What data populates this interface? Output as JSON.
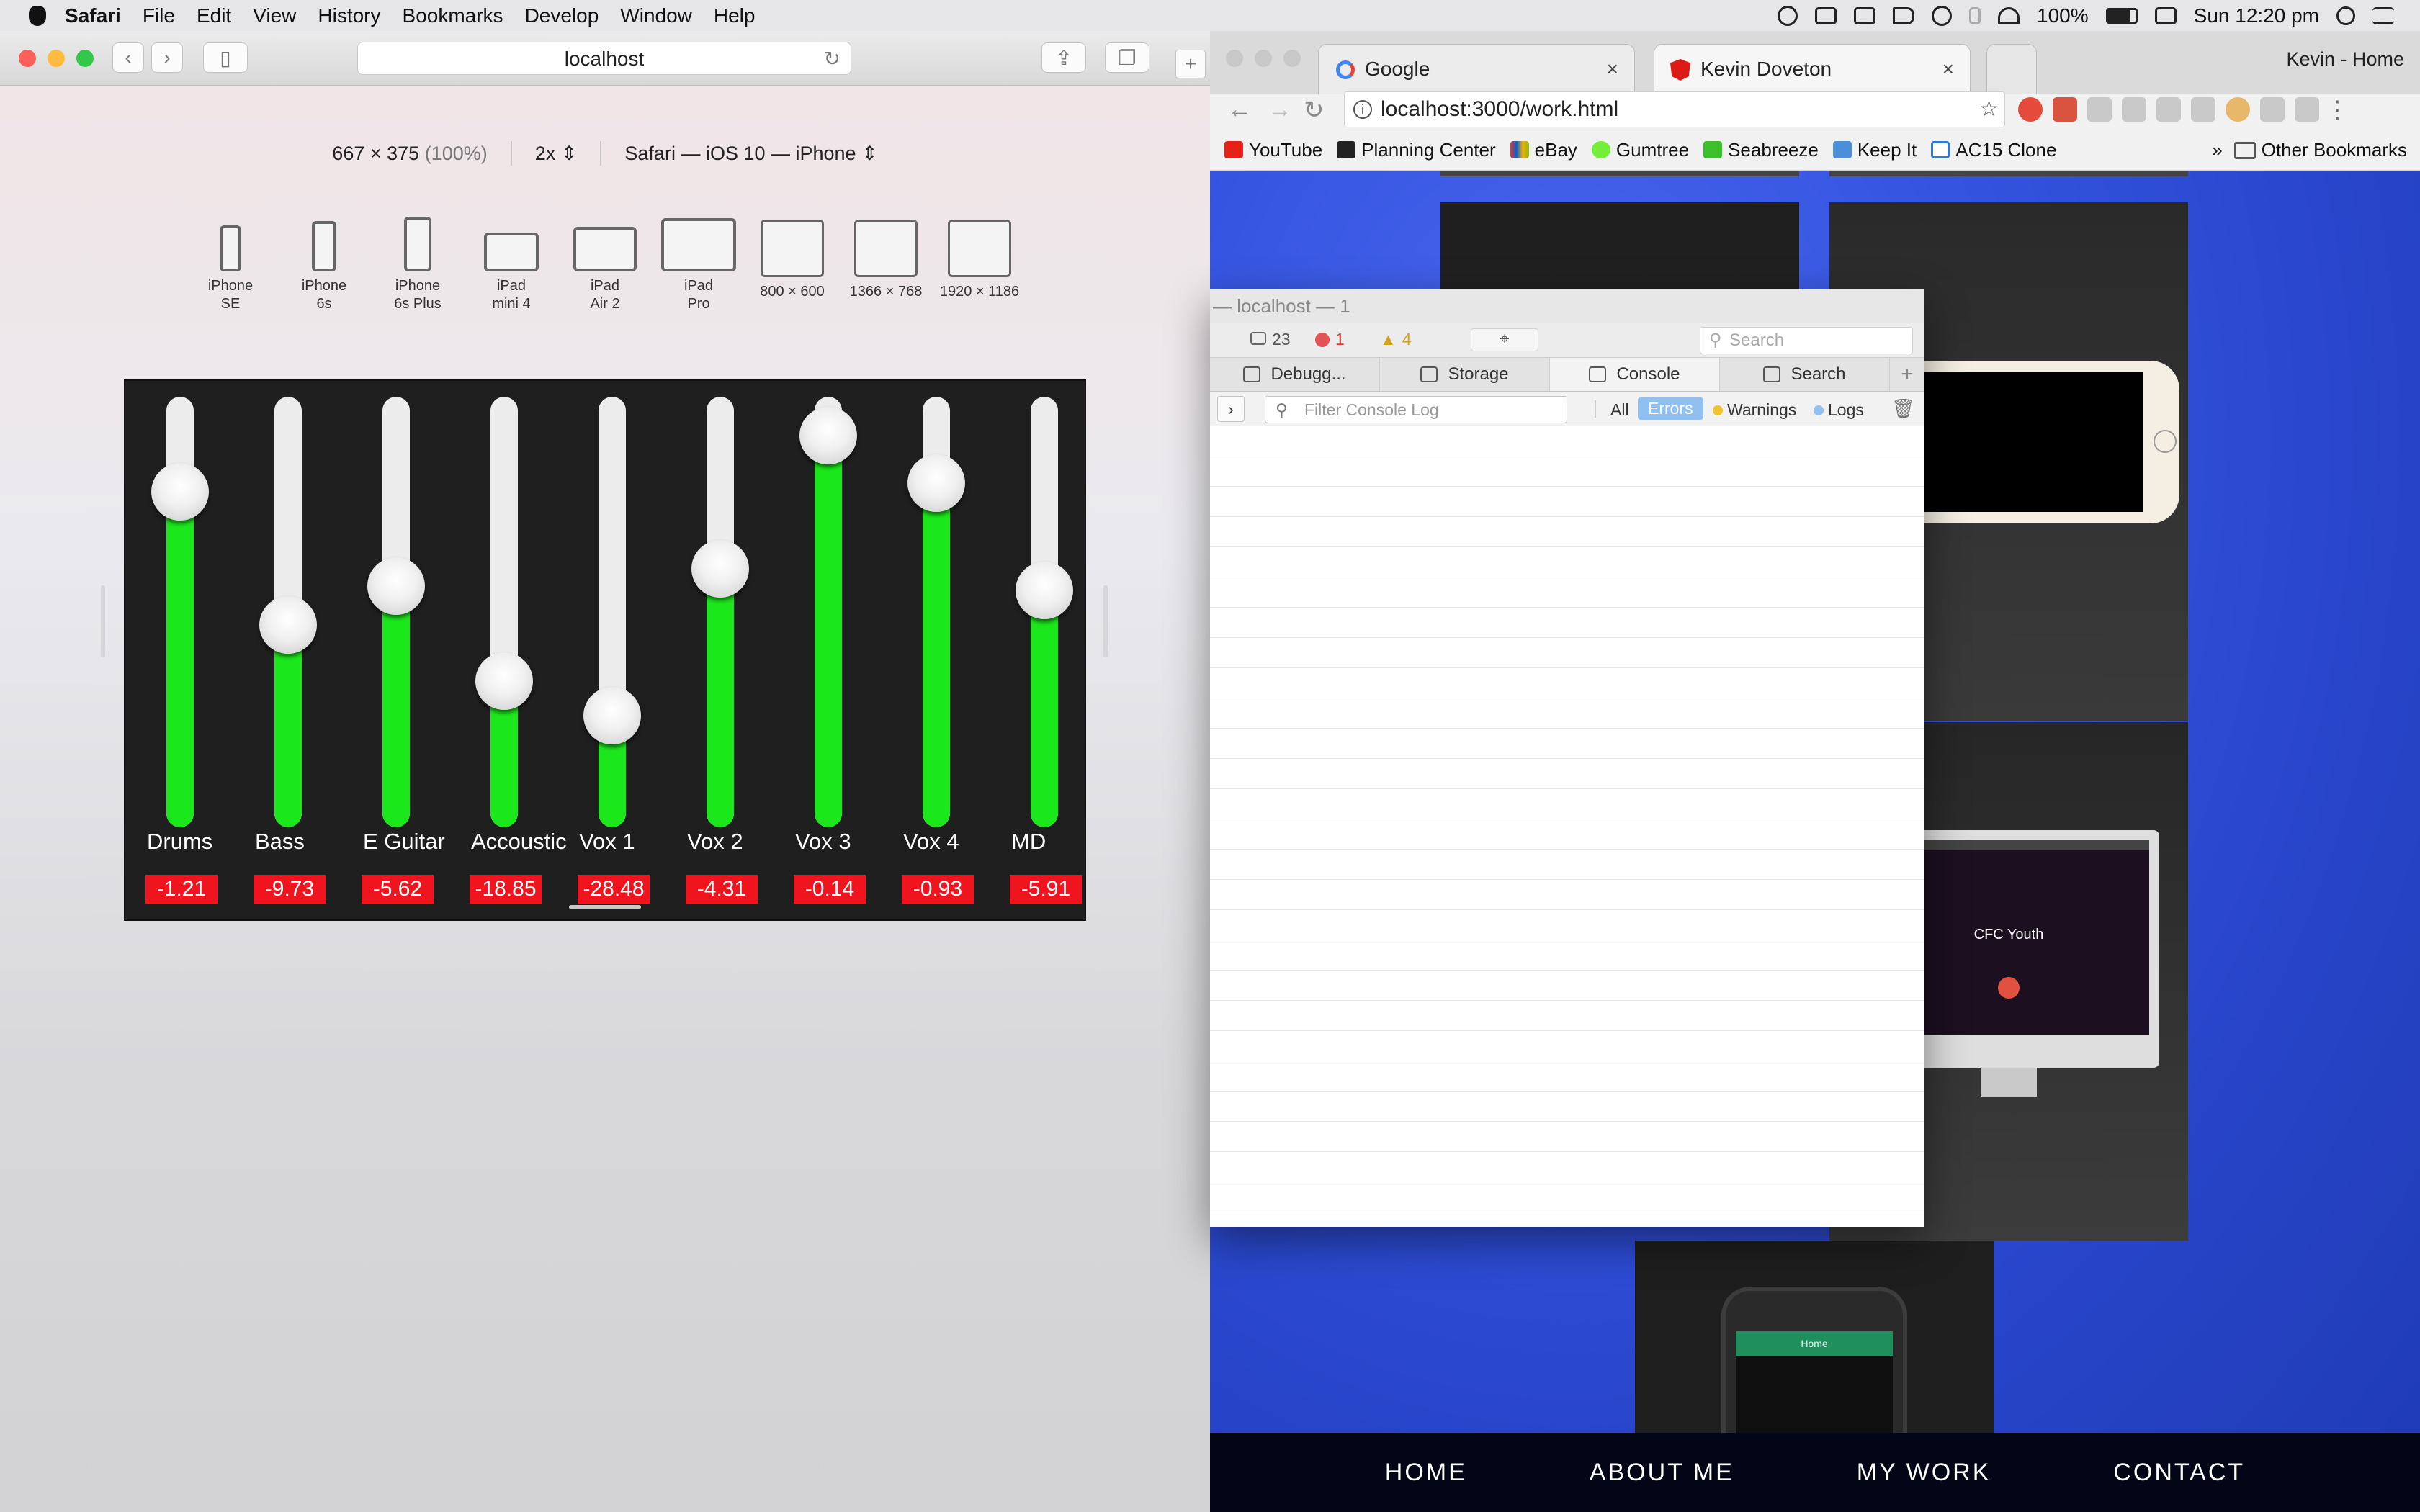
{
  "menubar": {
    "app": "Safari",
    "items": [
      "File",
      "Edit",
      "View",
      "History",
      "Bookmarks",
      "Develop",
      "Window",
      "Help"
    ],
    "battery": "100%",
    "clock": "Sun 12:20 pm"
  },
  "safari": {
    "url": "localhost",
    "responsive": {
      "size": "667 × 375",
      "zoom": "(100%)",
      "scale": "2x",
      "agent": "Safari — iOS 10 — iPhone"
    },
    "devices": [
      {
        "l1": "iPhone",
        "l2": "SE"
      },
      {
        "l1": "iPhone",
        "l2": "6s"
      },
      {
        "l1": "iPhone",
        "l2": "6s Plus"
      },
      {
        "l1": "iPad",
        "l2": "mini 4"
      },
      {
        "l1": "iPad",
        "l2": "Air 2"
      },
      {
        "l1": "iPad",
        "l2": "Pro"
      },
      {
        "l1": "800 × 600",
        "l2": ""
      },
      {
        "l1": "1366 × 768",
        "l2": ""
      },
      {
        "l1": "1920 × 1186",
        "l2": ""
      }
    ],
    "mixer": {
      "fill_color": "#1be81b",
      "value_bg": "#f0141e",
      "channels": [
        {
          "name": "Drums",
          "value": "-1.21",
          "level": 0.78
        },
        {
          "name": "Bass",
          "value": "-9.73",
          "level": 0.47
        },
        {
          "name": "E Guitar",
          "value": "-5.62",
          "level": 0.56
        },
        {
          "name": "Accoustic",
          "value": "-18.85",
          "level": 0.34
        },
        {
          "name": "Vox 1",
          "value": "-28.48",
          "level": 0.26
        },
        {
          "name": "Vox 2",
          "value": "-4.31",
          "level": 0.6
        },
        {
          "name": "Vox 3",
          "value": "-0.14",
          "level": 0.91
        },
        {
          "name": "Vox 4",
          "value": "-0.93",
          "level": 0.8
        },
        {
          "name": "MD",
          "value": "-5.91",
          "level": 0.55
        }
      ]
    }
  },
  "chrome": {
    "tabs": [
      {
        "title": "Google"
      },
      {
        "title": "Kevin Doveton"
      }
    ],
    "profile": "Kevin - Home",
    "url": "localhost:3000/work.html",
    "bookmarks": [
      "YouTube",
      "Planning Center",
      "eBay",
      "Gumtree",
      "Seabreeze",
      "Keep It",
      "AC15 Clone"
    ],
    "other_bookmarks": "Other Bookmarks",
    "preview_title": "CFC Youth",
    "phone_home": "Home",
    "footer_nav": [
      "HOME",
      "ABOUT ME",
      "MY WORK",
      "CONTACT"
    ]
  },
  "inspector": {
    "title": "— localhost — 1",
    "counts": {
      "messages": "23",
      "errors": "1",
      "warnings": "4"
    },
    "search_placeholder": "Search",
    "tabs": [
      "Debugg...",
      "Storage",
      "Console",
      "Search"
    ],
    "filter_placeholder": "Filter Console Log",
    "levels": {
      "all": "All",
      "errors": "Errors",
      "warnings": "Warnings",
      "logs": "Logs"
    }
  }
}
